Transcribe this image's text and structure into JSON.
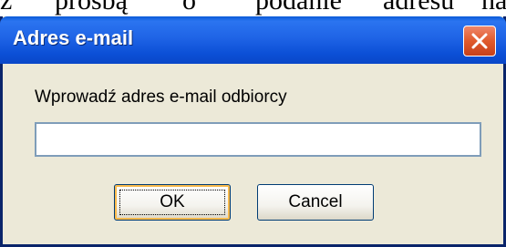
{
  "background_text": [
    "z",
    "prośbą",
    "o",
    "podanie",
    "adresu",
    "na"
  ],
  "dialog": {
    "title": "Adres e-mail",
    "prompt": "Wprowadź adres e-mail odbiorcy",
    "input": {
      "value": "",
      "placeholder": ""
    },
    "ok_label": "OK",
    "cancel_label": "Cancel"
  },
  "colors": {
    "titlebar": "#1f64e6",
    "dialog_bg": "#ece9d8",
    "close_button": "#e05a2c"
  },
  "icons": {
    "close": "close-x-icon"
  }
}
